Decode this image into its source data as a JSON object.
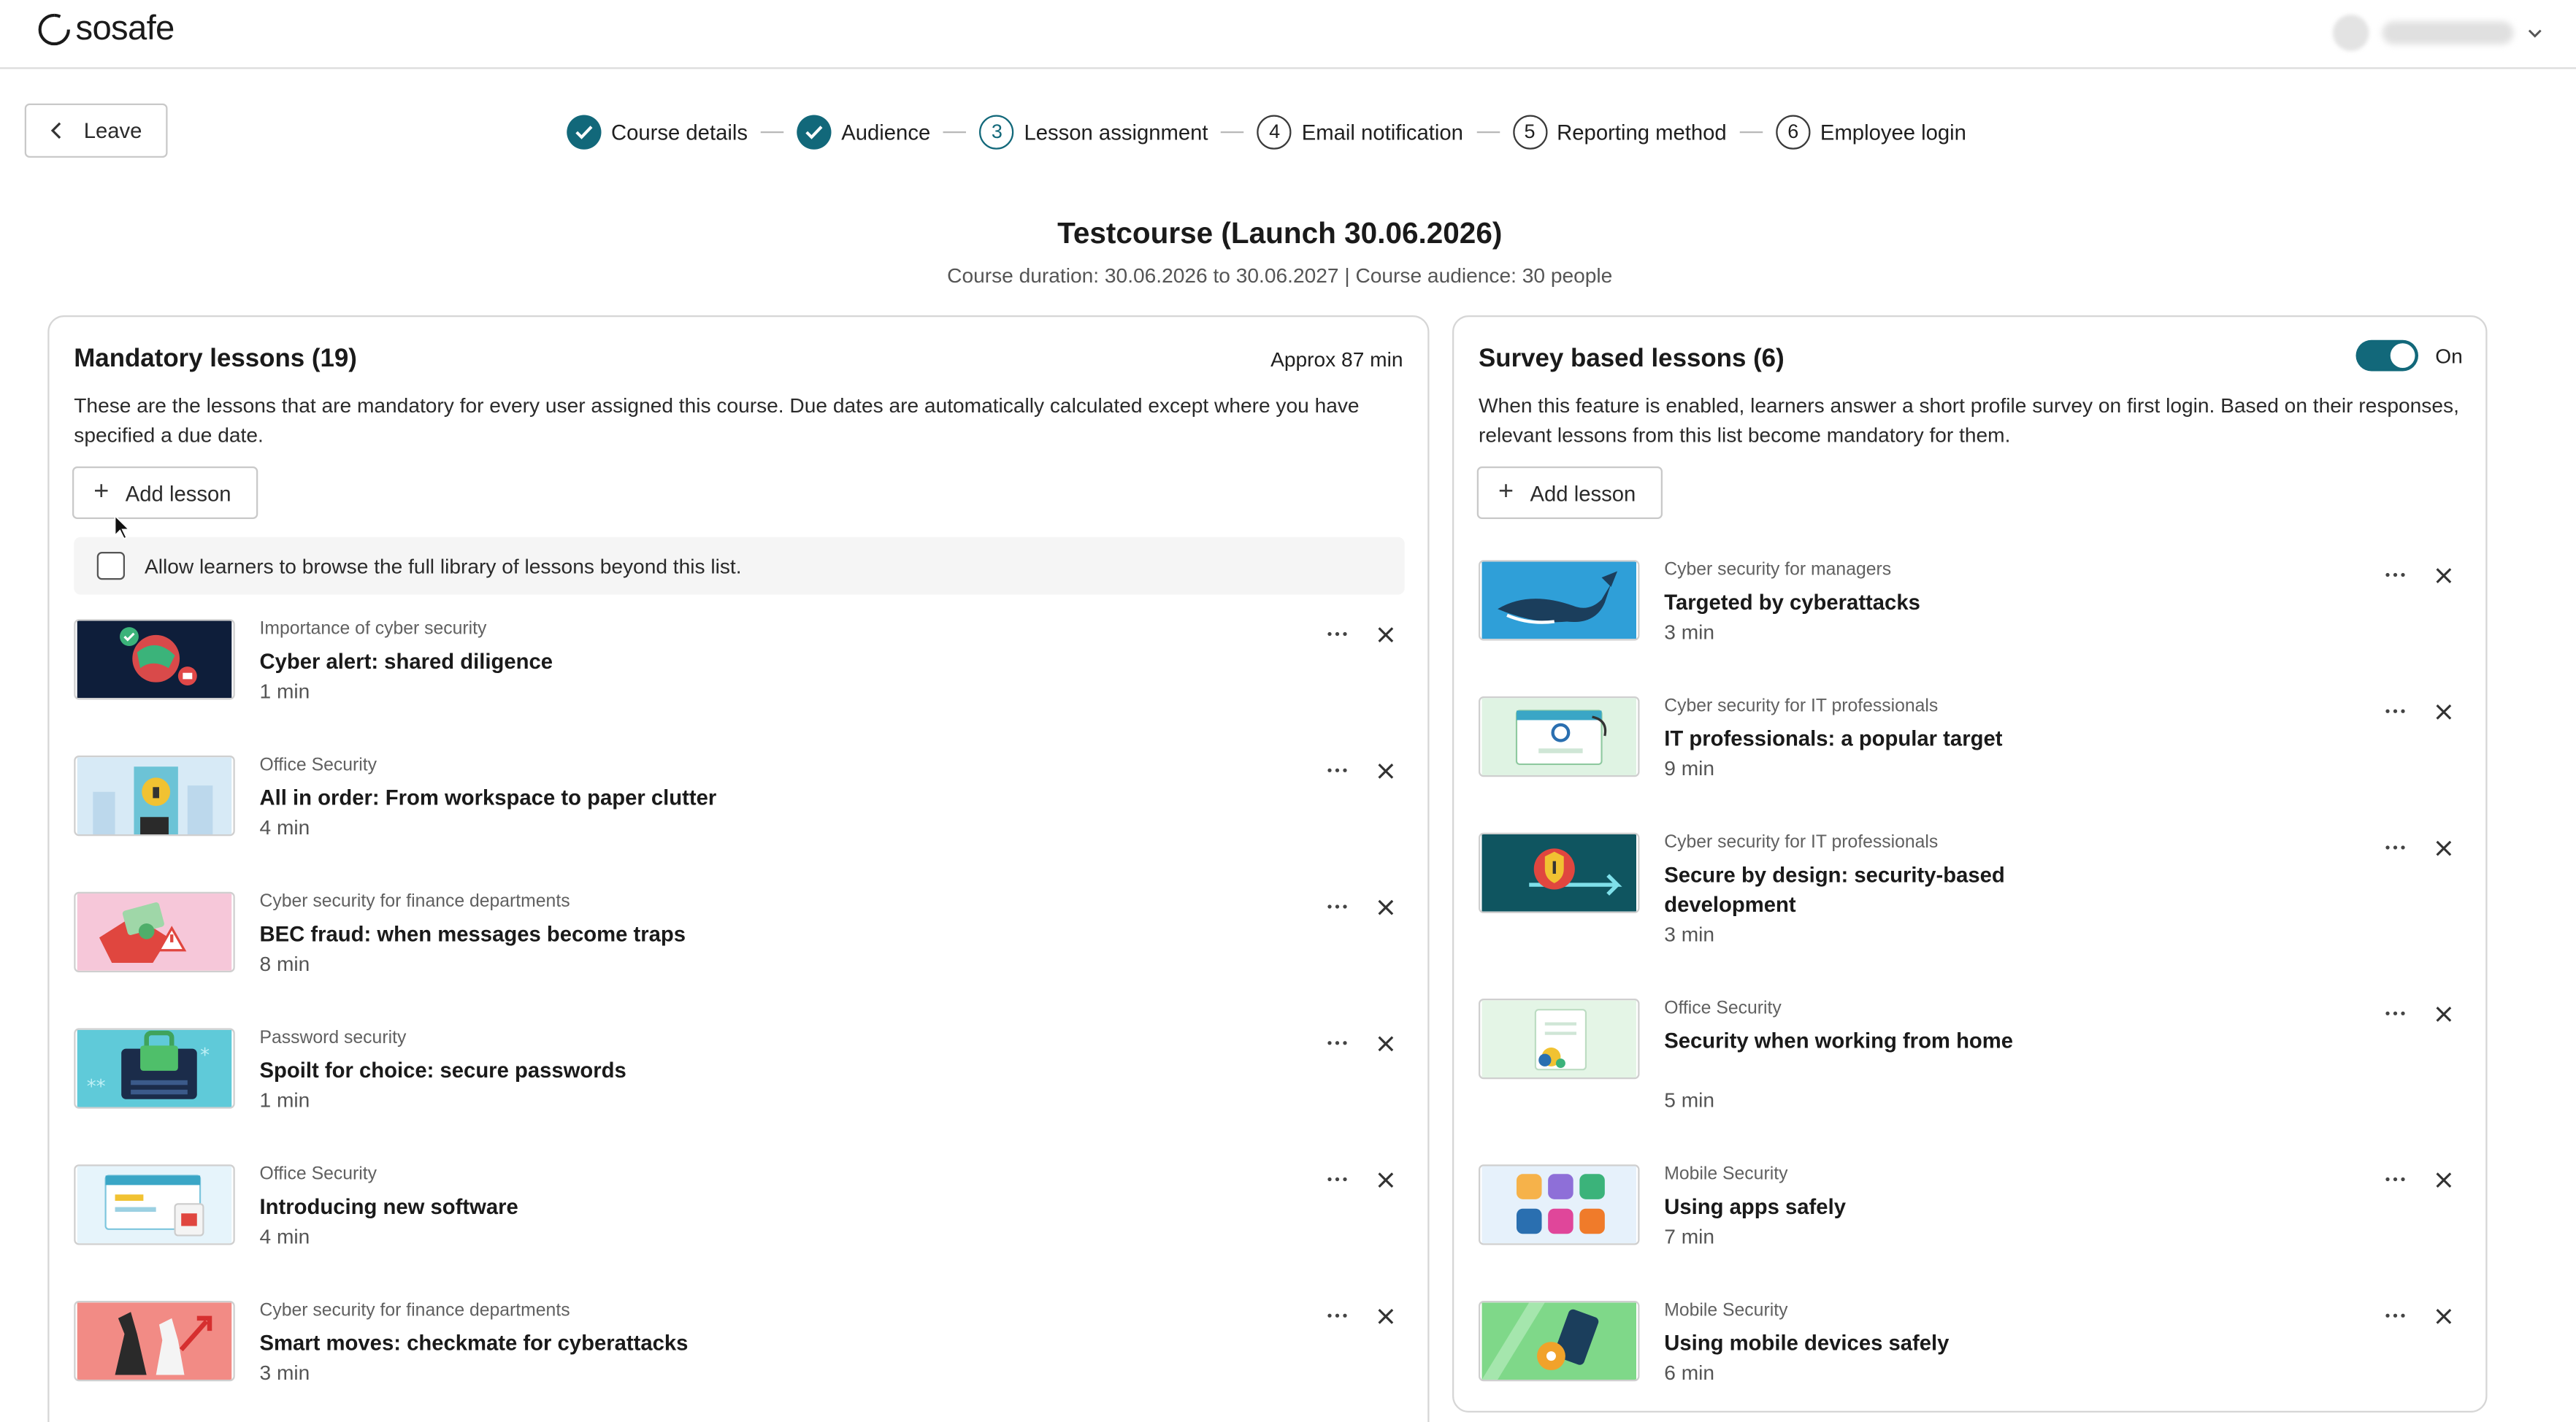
{
  "app": {
    "logo_text": "sosafe"
  },
  "header": {
    "leave_label": "Leave"
  },
  "stepper": [
    {
      "number": "1",
      "label": "Course details",
      "state": "done"
    },
    {
      "number": "2",
      "label": "Audience",
      "state": "done"
    },
    {
      "number": "3",
      "label": "Lesson assignment",
      "state": "active"
    },
    {
      "number": "4",
      "label": "Email notification",
      "state": "todo"
    },
    {
      "number": "5",
      "label": "Reporting method",
      "state": "todo"
    },
    {
      "number": "6",
      "label": "Employee login",
      "state": "todo"
    }
  ],
  "course": {
    "title": "Testcourse (Launch 30.06.2026)",
    "subtitle": "Course duration: 30.06.2026 to 30.06.2027 | Course audience: 30 people"
  },
  "mandatory": {
    "title": "Mandatory lessons (19)",
    "approx": "Approx 87 min",
    "description": "These are the lessons that are mandatory for every user assigned this course. Due dates are automatically calculated except where you have specified a due date.",
    "add_label": "Add lesson",
    "browse_label": "Allow learners to browse the full library of lessons beyond this list.",
    "browse_checked": false,
    "lessons": [
      {
        "category": "Importance of cyber security",
        "title": "Cyber alert: shared diligence",
        "duration": "1 min",
        "thumb_icon": "cyber-alert-thumbnail"
      },
      {
        "category": "Office Security",
        "title": "All in order: From workspace to paper clutter",
        "duration": "4 min",
        "thumb_icon": "office-building-lock-thumbnail"
      },
      {
        "category": "Cyber security for finance departments",
        "title": "BEC fraud: when messages become traps",
        "duration": "8 min",
        "thumb_icon": "bec-fraud-thumbnail"
      },
      {
        "category": "Password security",
        "title": "Spoilt for choice: secure passwords",
        "duration": "1 min",
        "thumb_icon": "password-lock-thumbnail"
      },
      {
        "category": "Office Security",
        "title": "Introducing new software",
        "duration": "4 min",
        "thumb_icon": "new-software-thumbnail"
      },
      {
        "category": "Cyber security for finance departments",
        "title": "Smart moves: checkmate for cyberattacks",
        "duration": "3 min",
        "thumb_icon": "chess-thumbnail"
      }
    ]
  },
  "survey": {
    "title": "Survey based lessons (6)",
    "toggle_label": "On",
    "toggle_on": true,
    "description": "When this feature is enabled, learners answer a short profile survey on first login. Based on their responses, relevant lessons from this list become mandatory for them.",
    "add_label": "Add lesson",
    "lessons": [
      {
        "category": "Cyber security for managers",
        "title": "Targeted by cyberattacks",
        "duration": "3 min",
        "thumb_icon": "whale-thumbnail"
      },
      {
        "category": "Cyber security for IT professionals",
        "title": "IT professionals: a popular target",
        "duration": "9 min",
        "thumb_icon": "it-browser-thumbnail"
      },
      {
        "category": "Cyber security for IT professionals",
        "title": "Secure by design: security-based development",
        "duration": "3 min",
        "thumb_icon": "secure-design-thumbnail"
      },
      {
        "category": "Office Security",
        "title": "Security when working from home",
        "duration": "5 min",
        "thumb_icon": "home-office-thumbnail"
      },
      {
        "category": "Mobile Security",
        "title": "Using apps safely",
        "duration": "7 min",
        "thumb_icon": "apps-grid-thumbnail"
      },
      {
        "category": "Mobile Security",
        "title": "Using mobile devices safely",
        "duration": "6 min",
        "thumb_icon": "mobile-device-thumbnail"
      }
    ]
  },
  "colors": {
    "accent": "#12687a",
    "border": "#d6d6d6",
    "muted": "#606060"
  }
}
